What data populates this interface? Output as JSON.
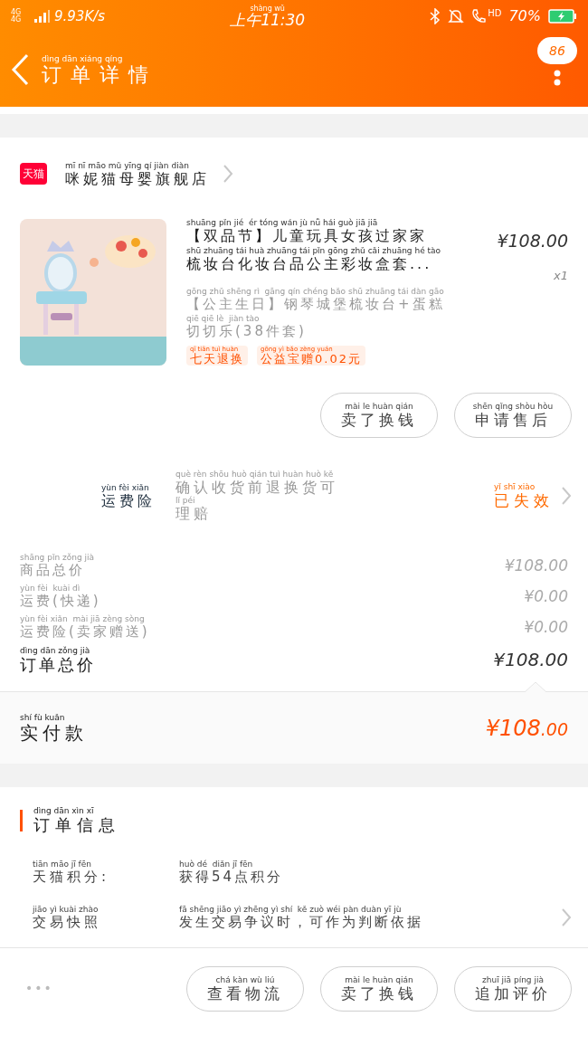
{
  "status_bar": {
    "network": "4G 4G",
    "speed": "9.93K/s",
    "time": {
      "pinyin": "shàng wǔ",
      "text": "上午11:30"
    },
    "hd": "HD",
    "battery": "70%"
  },
  "header": {
    "title": {
      "pinyin": "dìng dān xiáng qíng",
      "text": "订单详情"
    },
    "badge": "86"
  },
  "shop": {
    "logo": "天猫",
    "name": {
      "pinyin": "mī nī māo mǔ yīng qí jiàn diàn",
      "text": "咪妮猫母婴旗舰店"
    }
  },
  "product": {
    "title_lines": [
      {
        "pinyin": "shuāng pǐn jié  ér tóng wán jù nǚ hái guò jiā jiā",
        "text": "【双品节】儿童玩具女孩过家家"
      },
      {
        "pinyin": "shū zhuāng tái huà zhuāng tái pǐn gōng zhǔ cǎi zhuāng hé tào",
        "text": "梳妆台化妆台品公主彩妆盒套..."
      }
    ],
    "sku_lines": [
      {
        "pinyin": "gōng zhǔ shēng rì  gāng qín chéng bǎo shū zhuāng tái dàn gāo",
        "text": "【公主生日】钢琴城堡梳妆台+蛋糕"
      },
      {
        "pinyin": "qiē qiē lè  jiàn tào",
        "text": "切切乐(38件套)"
      }
    ],
    "tags": [
      {
        "pinyin": "qī tiān tuì huàn",
        "text": "七天退换"
      },
      {
        "pinyin": "gōng yì bǎo zèng yuán",
        "text": "公益宝赠0.02元"
      }
    ],
    "price": "¥108.00",
    "quantity": "x1",
    "buttons": [
      {
        "pinyin": "mài le huàn qián",
        "text": "卖了换钱"
      },
      {
        "pinyin": "shēn qǐng shòu hòu",
        "text": "申请售后"
      }
    ]
  },
  "insurance": {
    "label": {
      "pinyin": "yùn fèi xiǎn",
      "text": "运费险"
    },
    "description_lines": [
      {
        "pinyin": "què rèn shōu huò qián tuì huàn huò kě",
        "text": "确认收货前退换货可"
      },
      {
        "pinyin": "lǐ péi",
        "text": "理赔"
      }
    ],
    "status": {
      "pinyin": "yǐ shī xiào",
      "text": "已失效"
    }
  },
  "costs": [
    {
      "kind": "minor",
      "label": {
        "pinyin": "shāng pǐn zǒng jià",
        "text": "商品总价"
      },
      "value": "¥108.00"
    },
    {
      "kind": "minor",
      "label": {
        "pinyin": "yùn fèi  kuài dì",
        "text": "运费(快递)"
      },
      "value": "¥0.00"
    },
    {
      "kind": "minor",
      "label": {
        "pinyin": "yùn fèi xiǎn  mài jiā zèng sòng",
        "text": "运费险(卖家赠送)"
      },
      "value": "¥0.00"
    },
    {
      "kind": "total",
      "label": {
        "pinyin": "dìng dān zǒng jià",
        "text": "订单总价"
      },
      "value": "¥108.00"
    }
  ],
  "paid": {
    "label": {
      "pinyin": "shí fù kuǎn",
      "text": "实付款"
    },
    "value": "¥108",
    "cents": ".00"
  },
  "order_info": {
    "title": {
      "pinyin": "dìng dān xìn xī",
      "text": "订单信息"
    },
    "rows": [
      {
        "label": {
          "pinyin": "tiān māo jī fēn",
          "text": "天猫积分:"
        },
        "value": {
          "pinyin": "huò dé  diǎn jī fēn",
          "text": "获得54点积分"
        },
        "chevron": false
      },
      {
        "label": {
          "pinyin": "jiāo yì kuài zhào",
          "text": "交易快照"
        },
        "value": {
          "pinyin": "fā shēng jiāo yì zhēng yì shí  kě zuò wéi pàn duàn yī jù",
          "text": "发生交易争议时，可作为判断依据"
        },
        "chevron": true
      }
    ]
  },
  "bottom_bar": {
    "more": "•••",
    "buttons": [
      {
        "pinyin": "chá kàn wù liú",
        "text": "查看物流"
      },
      {
        "pinyin": "mài le huàn qián",
        "text": "卖了换钱"
      },
      {
        "pinyin": "zhuī jiā píng jià",
        "text": "追加评价"
      }
    ]
  }
}
